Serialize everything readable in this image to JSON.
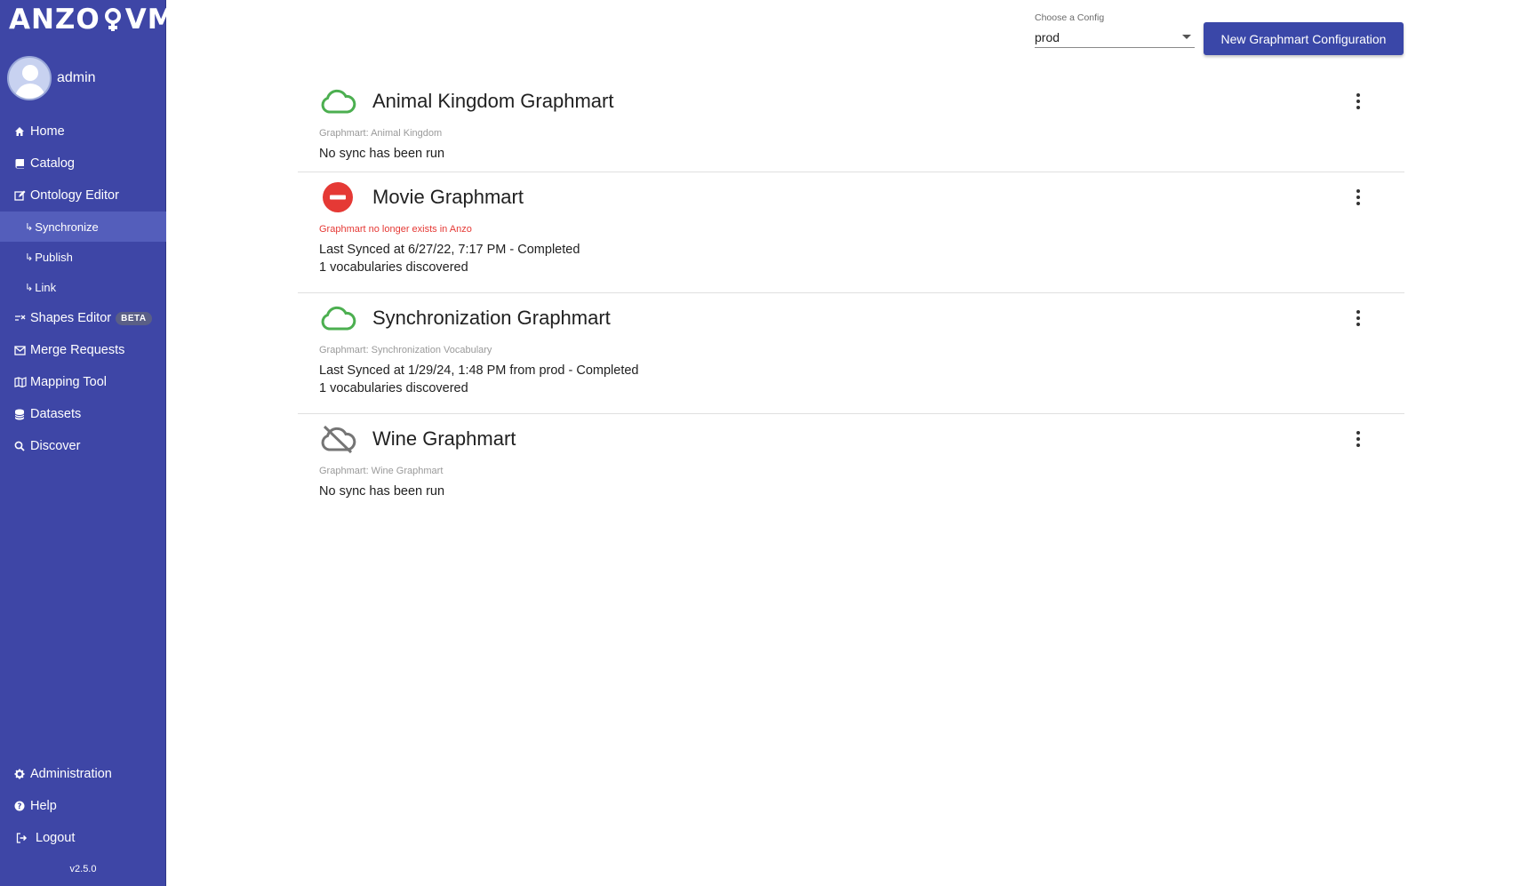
{
  "app": {
    "logo_text_1": "ANZO",
    "logo_text_2": "VM",
    "version": "v2.5.0"
  },
  "user": {
    "name": "admin"
  },
  "sidebar": {
    "items": [
      {
        "label": "Home",
        "icon": "home-icon"
      },
      {
        "label": "Catalog",
        "icon": "book-icon"
      },
      {
        "label": "Ontology Editor",
        "icon": "edit-icon"
      }
    ],
    "subitems": [
      {
        "label": "Synchronize",
        "active": true
      },
      {
        "label": "Publish",
        "active": false
      },
      {
        "label": "Link",
        "active": false
      }
    ],
    "items2": [
      {
        "label": "Shapes Editor",
        "icon": "shapes-icon",
        "badge": "BETA"
      },
      {
        "label": "Merge Requests",
        "icon": "envelope-icon"
      },
      {
        "label": "Mapping Tool",
        "icon": "map-icon"
      },
      {
        "label": "Datasets",
        "icon": "database-icon"
      },
      {
        "label": "Discover",
        "icon": "search-icon"
      }
    ],
    "bottom": [
      {
        "label": "Administration",
        "icon": "gear-icon"
      },
      {
        "label": "Help",
        "icon": "help-icon"
      },
      {
        "label": "Logout",
        "icon": "logout-icon"
      }
    ]
  },
  "config": {
    "label": "Choose a Config",
    "value": "prod"
  },
  "new_button": "New Graphmart Configuration",
  "graphmarts": [
    {
      "title": "Animal Kingdom Graphmart",
      "status": "cloud-ok",
      "subtitle": "Graphmart: Animal Kingdom",
      "lines": [
        "No sync has been run"
      ]
    },
    {
      "title": "Movie Graphmart",
      "status": "error",
      "subtitle": "Graphmart no longer exists in Anzo",
      "lines": [
        "Last Synced at 6/27/22, 7:17 PM - Completed",
        "1 vocabularies discovered"
      ]
    },
    {
      "title": "Synchronization Graphmart",
      "status": "cloud-ok",
      "subtitle": "Graphmart: Synchronization Vocabulary",
      "lines": [
        "Last Synced at 1/29/24, 1:48 PM from prod - Completed",
        "1 vocabularies discovered"
      ]
    },
    {
      "title": "Wine Graphmart",
      "status": "cloud-off",
      "subtitle": "Graphmart: Wine Graphmart",
      "lines": [
        "No sync has been run"
      ]
    }
  ],
  "colors": {
    "sidebar": "#3e46a6",
    "active_item": "#545ebb",
    "button": "#3a47a8",
    "cloud_ok": "#4caf50",
    "error": "#e53935",
    "cloud_off": "#757575"
  }
}
